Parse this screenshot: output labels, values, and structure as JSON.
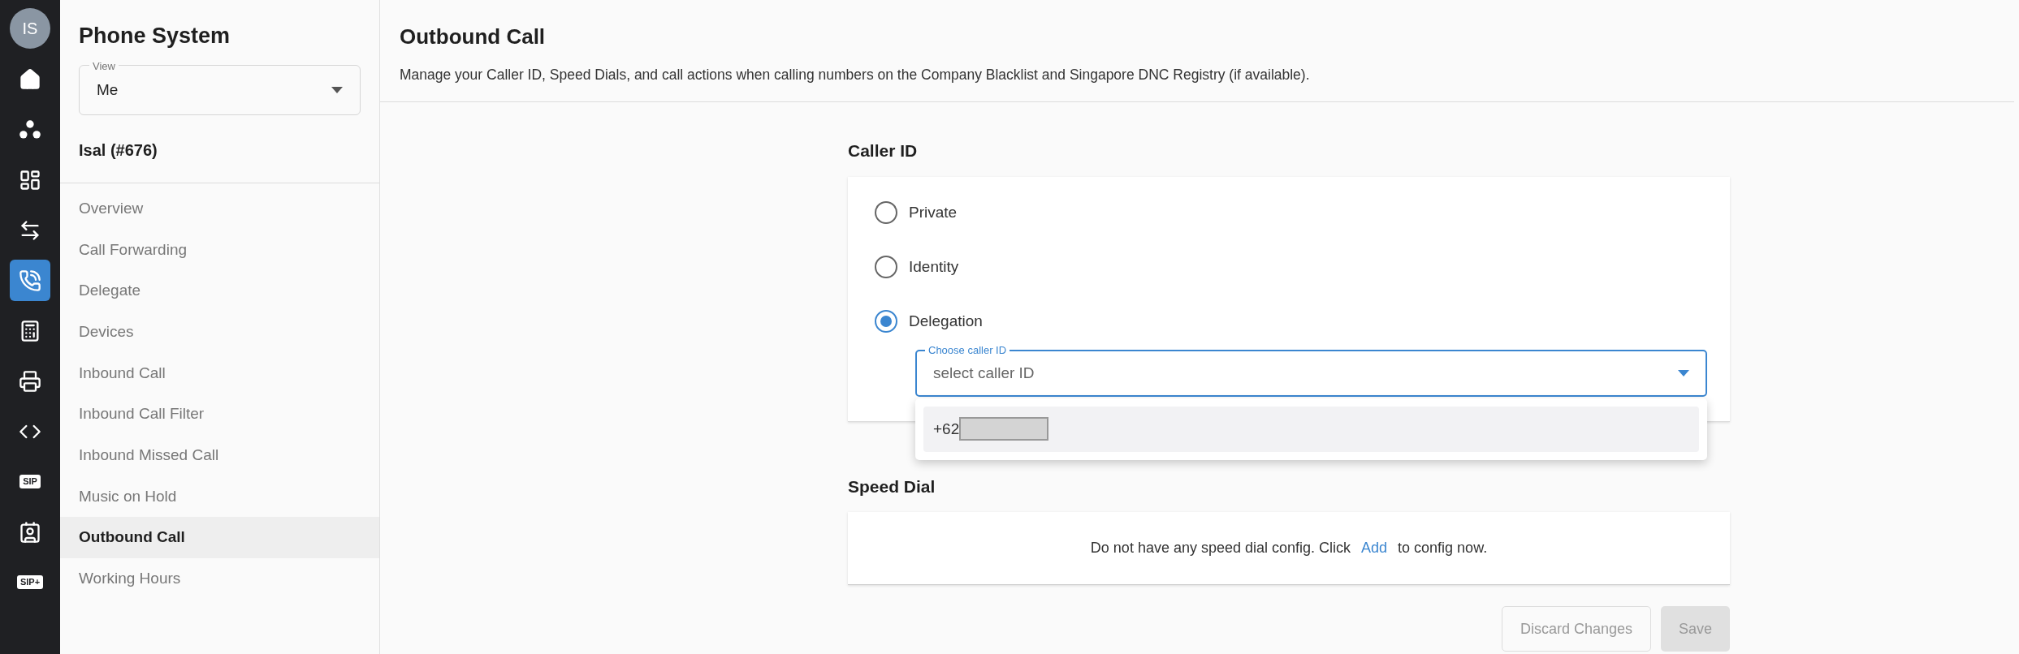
{
  "rail": {
    "avatar": "IS",
    "items": [
      {
        "kind": "icon",
        "selected": false
      },
      {
        "kind": "icon",
        "selected": false
      },
      {
        "kind": "icon",
        "selected": false
      },
      {
        "kind": "icon",
        "selected": false
      },
      {
        "kind": "icon",
        "selected": true
      },
      {
        "kind": "icon",
        "selected": false
      },
      {
        "kind": "icon",
        "selected": false
      },
      {
        "kind": "icon",
        "selected": false
      },
      {
        "kind": "badge",
        "label": "SIP",
        "selected": false
      },
      {
        "kind": "icon",
        "selected": false
      },
      {
        "kind": "badge",
        "label": "SIP+",
        "selected": false
      }
    ]
  },
  "sidebar": {
    "title": "Phone System",
    "view": {
      "label": "View",
      "value": "Me"
    },
    "user": "Isal (#676)",
    "items": [
      {
        "label": "Overview",
        "selected": false
      },
      {
        "label": "Call Forwarding",
        "selected": false
      },
      {
        "label": "Delegate",
        "selected": false
      },
      {
        "label": "Devices",
        "selected": false
      },
      {
        "label": "Inbound Call",
        "selected": false
      },
      {
        "label": "Inbound Call Filter",
        "selected": false
      },
      {
        "label": "Inbound Missed Call",
        "selected": false
      },
      {
        "label": "Music on Hold",
        "selected": false
      },
      {
        "label": "Outbound Call",
        "selected": true
      },
      {
        "label": "Working Hours",
        "selected": false
      }
    ]
  },
  "main": {
    "title": "Outbound Call",
    "description": "Manage your Caller ID, Speed Dials, and call actions when calling numbers on the Company Blacklist and Singapore DNC Registry (if available).",
    "caller_id": {
      "heading": "Caller ID",
      "options": [
        {
          "label": "Private",
          "selected": false
        },
        {
          "label": "Identity",
          "selected": false
        },
        {
          "label": "Delegation",
          "selected": true
        }
      ],
      "select": {
        "label": "Choose caller ID",
        "placeholder": "select caller ID",
        "expanded": true,
        "options": [
          {
            "label": "+62",
            "kind": "redacted"
          }
        ]
      }
    },
    "speed_dial": {
      "heading": "Speed Dial",
      "message_before": "Do not have any speed dial config. Click",
      "link": "Add",
      "message_after": "to config now."
    },
    "buttons": [
      {
        "label": "Discard Changes",
        "kind": "outline",
        "disabled": true
      },
      {
        "label": "Save",
        "kind": "filled",
        "disabled": true
      }
    ]
  }
}
